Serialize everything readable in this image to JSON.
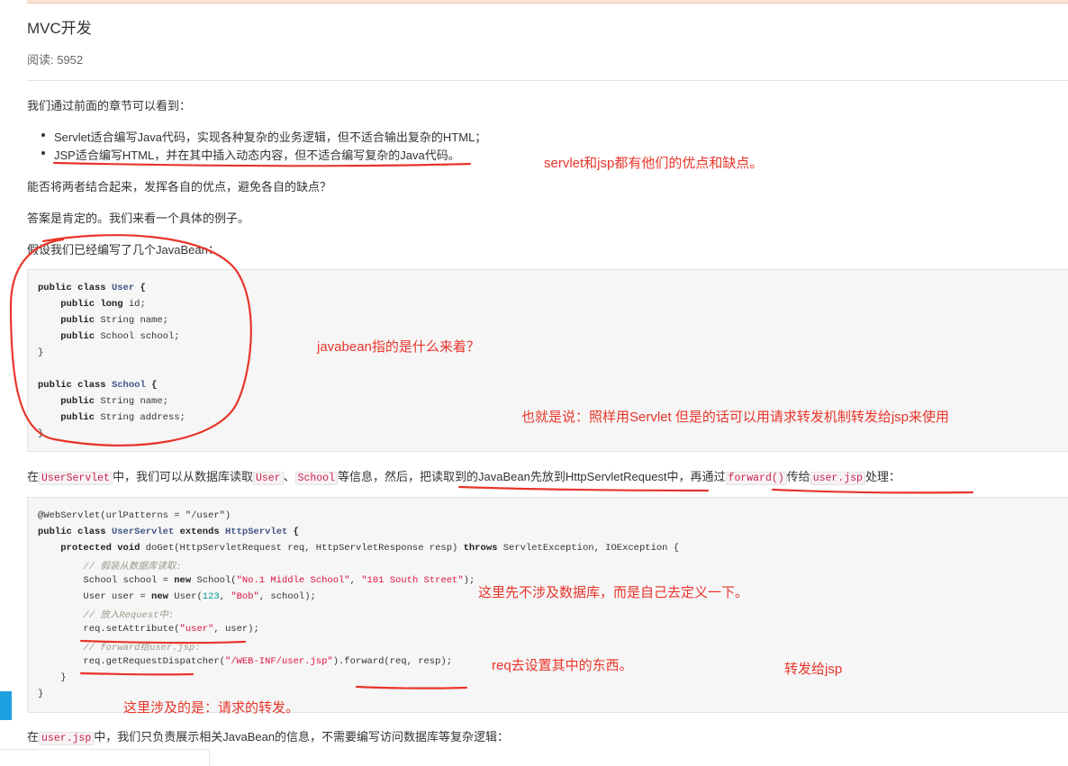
{
  "article": {
    "title": "MVC开发",
    "reads": "阅读: 5952",
    "intro": "我们通过前面的章节可以看到：",
    "bullets": [
      "Servlet适合编写Java代码，实现各种复杂的业务逻辑，但不适合输出复杂的HTML；",
      "JSP适合编写HTML，并在其中插入动态内容，但不适合编写复杂的Java代码。"
    ],
    "question": "能否将两者结合起来，发挥各自的优点，避免各自的缺点？",
    "answer": "答案是肯定的。我们来看一个具体的例子。",
    "assume": "假设我们已经编写了几个JavaBean：",
    "para_servlet": {
      "t1": "在",
      "c1": "UserServlet",
      "t2": "中，我们可以从数据库读取",
      "c2": "User",
      "t3": "、",
      "c3": "School",
      "t4": "等信息，然后，把读取到的JavaBean先放到HttpServletRequest中，再通过",
      "c4": "forward()",
      "t5": "传给",
      "c5": "user.jsp",
      "t6": "处理："
    },
    "para_jsp": {
      "t1": "在",
      "c1": "user.jsp",
      "t2": "中，我们只负责展示相关JavaBean的信息，不需要编写访问数据库等复杂逻辑："
    }
  },
  "code_bean": {
    "l1_kw": "public class",
    "l1_cls": "User",
    "l1_end": "{",
    "l2_kw": "public long",
    "l2_rest": "id;",
    "l3_kw": "public",
    "l3_rest": "String name;",
    "l4_kw": "public",
    "l4_rest": "School school;",
    "l5": "}",
    "l6_kw": "public class",
    "l6_cls": "School",
    "l6_end": "{",
    "l7_kw": "public",
    "l7_rest": "String name;",
    "l8_kw": "public",
    "l8_rest": "String address;",
    "l9": "}"
  },
  "code_servlet": {
    "l1": "@WebServlet(urlPatterns = \"/user\")",
    "l2_kw": "public class",
    "l2_cls": "UserServlet",
    "l2_kw2": "extends",
    "l2_cls2": "HttpServlet",
    "l2_end": "{",
    "l3_kw": "protected void",
    "l3_a": "doGet(HttpServletRequest req, HttpServletResponse resp)",
    "l3_kw2": "throws",
    "l3_b": "ServletException, IOException {",
    "l4": "// 假装从数据库读取:",
    "l5_a": "School school =",
    "l5_kw": "new",
    "l5_b": "School(",
    "l5_s1": "\"No.1 Middle School\"",
    "l5_c": ",",
    "l5_s2": "\"101 South Street\"",
    "l5_d": ");",
    "l6_a": "User user =",
    "l6_kw": "new",
    "l6_b": "User(",
    "l6_n": "123",
    "l6_c": ",",
    "l6_s": "\"Bob\"",
    "l6_d": ", school);",
    "l7": "// 放入Request中:",
    "l8_a": "req.setAttribute(",
    "l8_s": "\"user\"",
    "l8_b": ", user);",
    "l9": "// forward给user.jsp:",
    "l10_a": "req.getRequestDispatcher(",
    "l10_s": "\"/WEB-INF/user.jsp\"",
    "l10_b": ").forward(req, resp);",
    "l11": "}",
    "l12": "}"
  },
  "annotations": {
    "a1": "servlet和jsp都有他们的优点和缺点。",
    "a2": "javabean指的是什么来着？",
    "a3": "也就是说：照样用Servlet  但是的话可以用请求转发机制转发给jsp来使用",
    "a4": "这里先不涉及数据库，而是自己去定义一下。",
    "a5": "req去设置其中的东西。",
    "a6": "转发给jsp",
    "a7": "这里涉及的是：请求的转发。"
  },
  "colors": {
    "annotation": "#e8352b",
    "accent": "#1e9fe0",
    "code_bg": "#f6f6f6"
  }
}
